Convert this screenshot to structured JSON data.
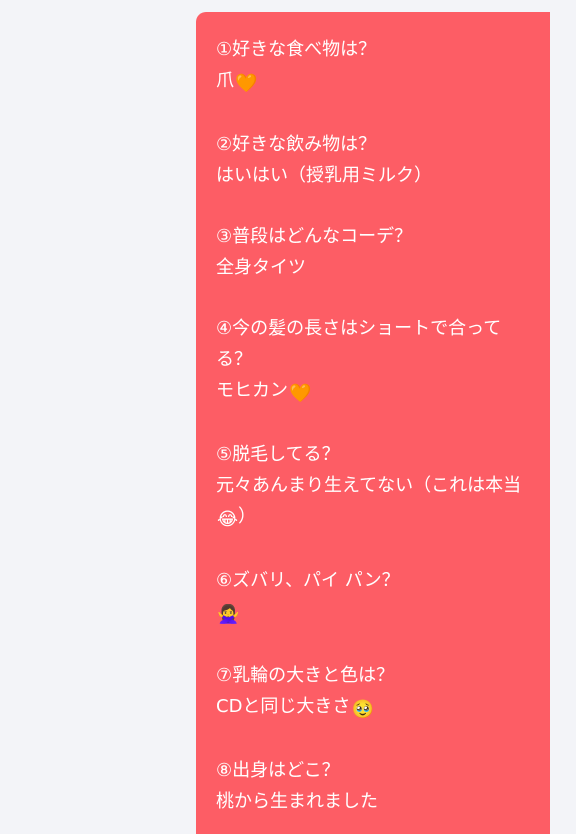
{
  "qa": [
    {
      "question": "①好きな食べ物は？",
      "answer": "爪",
      "emoji": "🧡"
    },
    {
      "question": "②好きな飲み物は？",
      "answer": "はいはい（授乳用ミルク）",
      "emoji": ""
    },
    {
      "question": "③普段はどんなコーデ？",
      "answer": "全身タイツ",
      "emoji": ""
    },
    {
      "question": "④今の髪の長さはショートで合ってる？",
      "answer": "モヒカン",
      "emoji": "🧡"
    },
    {
      "question": "⑤脱毛してる？",
      "answer": "元々あんまり生えてない（これは本当",
      "emoji": "😂",
      "answer_suffix": "）"
    },
    {
      "question": "⑥ズバリ、パイ パン？",
      "answer": "",
      "emoji": "🙅‍♀️"
    },
    {
      "question": "⑦乳輪の大きと色は？",
      "answer": "CDと同じ大きさ",
      "emoji": "🥹"
    },
    {
      "question": "⑧出身はどこ？",
      "answer": "桃から生まれました",
      "emoji": ""
    }
  ],
  "colors": {
    "background": "#f3f4f8",
    "bubble": "#fd5d65",
    "text": "#ffffff"
  }
}
